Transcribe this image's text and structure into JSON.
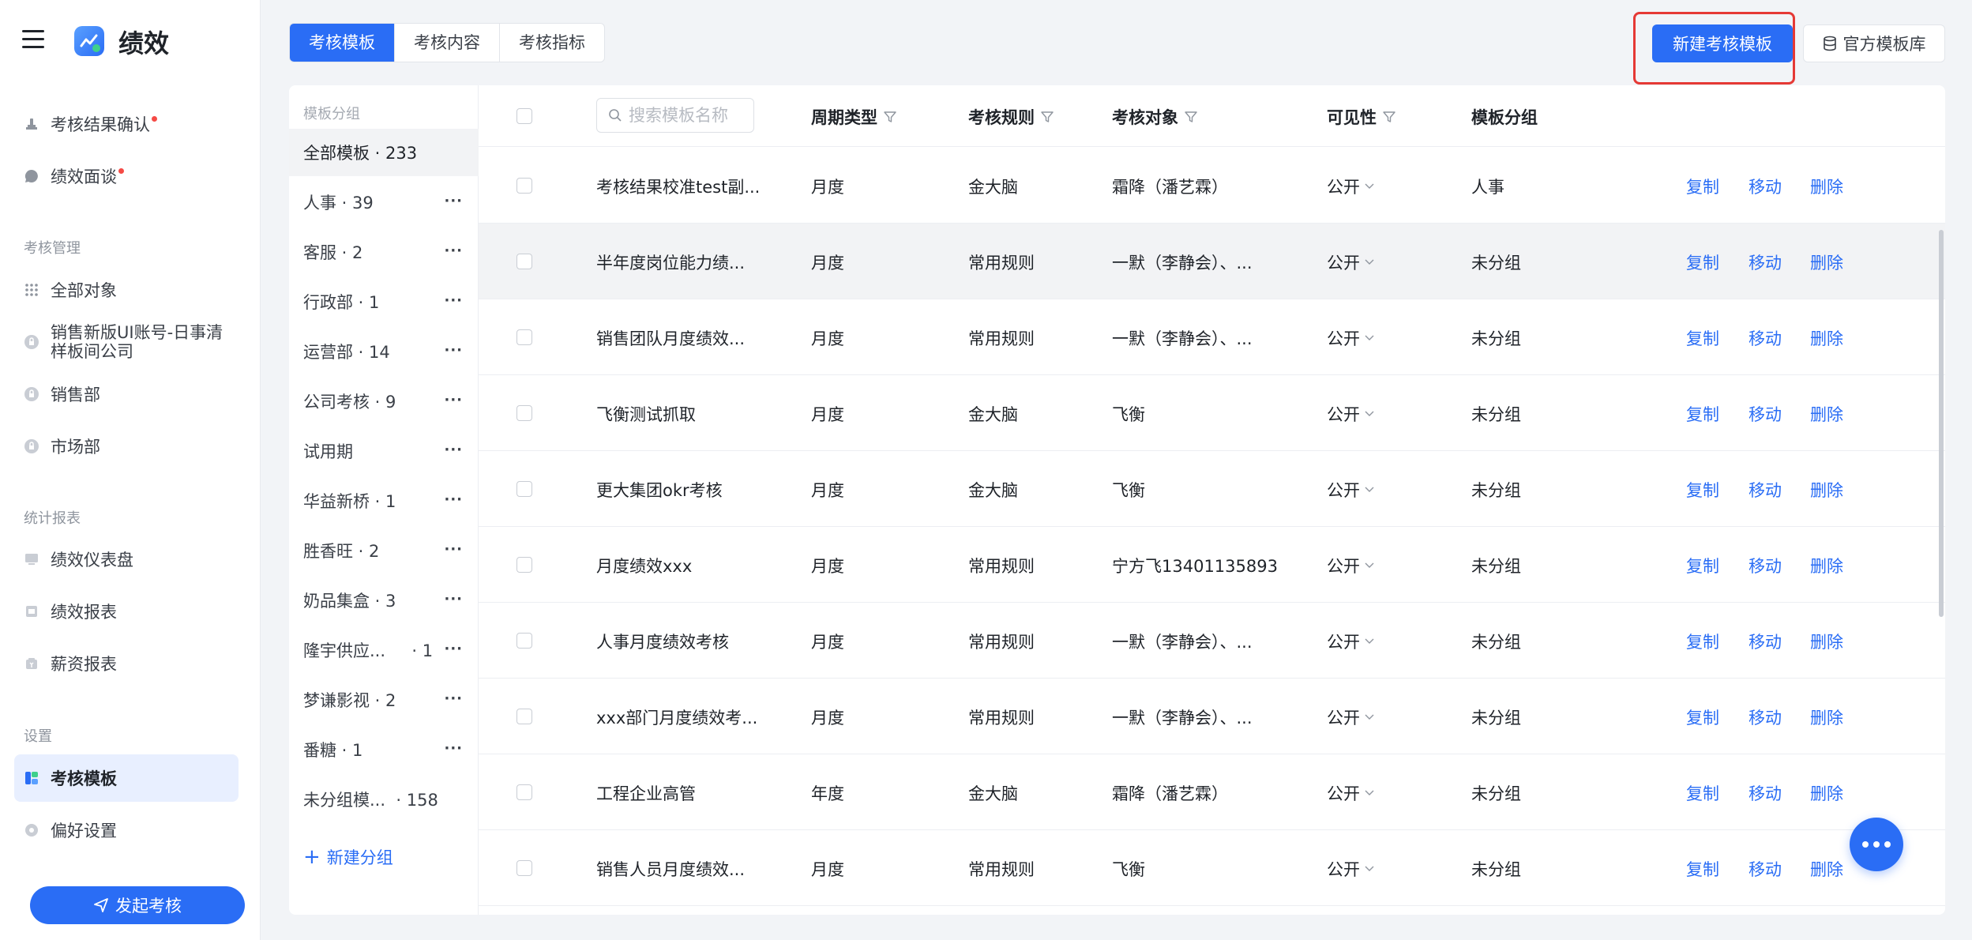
{
  "app": {
    "title": "绩效"
  },
  "sidebar": {
    "items_top": [
      {
        "label": "考核结果确认",
        "icon": "stamp-icon",
        "dot": true
      },
      {
        "label": "绩效面谈",
        "icon": "chat-icon",
        "dot": true
      }
    ],
    "section_manage": "考核管理",
    "items_manage": [
      {
        "label": "全部对象",
        "icon": "grid-dots-icon"
      },
      {
        "label": "销售新版UI账号-日事清样板间公司",
        "icon": "lock-icon"
      },
      {
        "label": "销售部",
        "icon": "lock-icon"
      },
      {
        "label": "市场部",
        "icon": "lock-icon"
      }
    ],
    "section_reports": "统计报表",
    "items_reports": [
      {
        "label": "绩效仪表盘",
        "icon": "monitor-icon"
      },
      {
        "label": "绩效报表",
        "icon": "report-icon"
      },
      {
        "label": "薪资报表",
        "icon": "salary-icon"
      }
    ],
    "section_settings": "设置",
    "items_settings": [
      {
        "label": "考核模板",
        "icon": "template-icon",
        "active": true
      },
      {
        "label": "偏好设置",
        "icon": "settings-icon"
      }
    ],
    "launch_label": "发起考核"
  },
  "tabs": [
    {
      "label": "考核模板",
      "active": true
    },
    {
      "label": "考核内容"
    },
    {
      "label": "考核指标"
    }
  ],
  "toolbar": {
    "new_template_label": "新建考核模板",
    "official_library_label": "官方模板库"
  },
  "groups": {
    "title": "模板分组",
    "items": [
      {
        "label": "全部模板 · 233",
        "active": true,
        "more": false
      },
      {
        "label": "人事 · 39",
        "more": true
      },
      {
        "label": "客服 · 2",
        "more": true
      },
      {
        "label": "行政部 · 1",
        "more": true
      },
      {
        "label": "运营部 · 14",
        "more": true
      },
      {
        "label": "公司考核 · 9",
        "more": true
      },
      {
        "label": "试用期",
        "more": true
      },
      {
        "label": "华益新桥 · 1",
        "more": true
      },
      {
        "label": "胜香旺 · 2",
        "more": true
      },
      {
        "label": "奶品集盒 · 3",
        "more": true
      },
      {
        "label": "隆宇供应...     · 1",
        "more": true
      },
      {
        "label": "梦谦影视 · 2",
        "more": true
      },
      {
        "label": "番糖 · 1",
        "more": true
      },
      {
        "label": "未分组模...  · 158",
        "more": false
      }
    ],
    "new_group_label": "新建分组"
  },
  "table": {
    "search_placeholder": "搜索模板名称",
    "headers": {
      "cycle": "周期类型",
      "rule": "考核规则",
      "target": "考核对象",
      "visibility": "可见性",
      "group": "模板分组"
    },
    "actions": {
      "copy": "复制",
      "move": "移动",
      "delete": "删除"
    },
    "rows": [
      {
        "name": "考核结果校准test副...",
        "cycle": "月度",
        "rule": "金大脑",
        "target": "霜降（潘艺霖）",
        "visibility": "公开",
        "group": "人事"
      },
      {
        "name": "半年度岗位能力绩...",
        "cycle": "月度",
        "rule": "常用规则",
        "target": "一默（李静会）、...",
        "visibility": "公开",
        "group": "未分组"
      },
      {
        "name": "销售团队月度绩效...",
        "cycle": "月度",
        "rule": "常用规则",
        "target": "一默（李静会）、...",
        "visibility": "公开",
        "group": "未分组"
      },
      {
        "name": "飞衡测试抓取",
        "cycle": "月度",
        "rule": "金大脑",
        "target": "飞衡",
        "visibility": "公开",
        "group": "未分组"
      },
      {
        "name": "更大集团okr考核",
        "cycle": "月度",
        "rule": "金大脑",
        "target": "飞衡",
        "visibility": "公开",
        "group": "未分组"
      },
      {
        "name": "月度绩效xxx",
        "cycle": "月度",
        "rule": "常用规则",
        "target": "宁方飞13401135893",
        "visibility": "公开",
        "group": "未分组"
      },
      {
        "name": "人事月度绩效考核",
        "cycle": "月度",
        "rule": "常用规则",
        "target": "一默（李静会）、...",
        "visibility": "公开",
        "group": "未分组"
      },
      {
        "name": "xxx部门月度绩效考...",
        "cycle": "月度",
        "rule": "常用规则",
        "target": "一默（李静会）、...",
        "visibility": "公开",
        "group": "未分组"
      },
      {
        "name": "工程企业高管",
        "cycle": "年度",
        "rule": "金大脑",
        "target": "霜降（潘艺霖）",
        "visibility": "公开",
        "group": "未分组"
      },
      {
        "name": "销售人员月度绩效...",
        "cycle": "月度",
        "rule": "常用规则",
        "target": "飞衡",
        "visibility": "公开",
        "group": "未分组"
      }
    ]
  },
  "colors": {
    "accent": "#2a6df5",
    "highlight_border": "#e53935",
    "dot": "#f54a45"
  },
  "floating_button": {
    "icon": "more-dots-icon"
  }
}
